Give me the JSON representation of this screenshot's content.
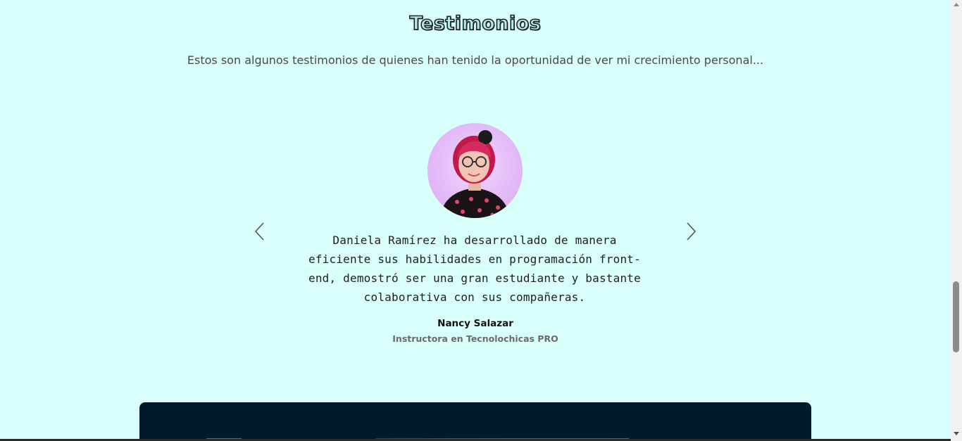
{
  "section": {
    "title": "Testimonios",
    "subtitle": "Estos son algunos testimonios de quienes han tenido la oportunidad de ver mi crecimiento personal..."
  },
  "testimonial": {
    "quote": "Daniela Ramírez ha desarrollado de manera eficiente sus habilidades en programación front-end, demostró ser una gran estudiante y bastante colaborativa con sus compañeras.",
    "author": "Nancy Salazar",
    "role": "Instructora en Tecnolochicas PRO"
  },
  "carousel": {
    "prev_icon": "chevron-left-icon",
    "next_icon": "chevron-right-icon"
  },
  "colors": {
    "background": "#d9fffb",
    "dark_card": "#001a2c"
  }
}
